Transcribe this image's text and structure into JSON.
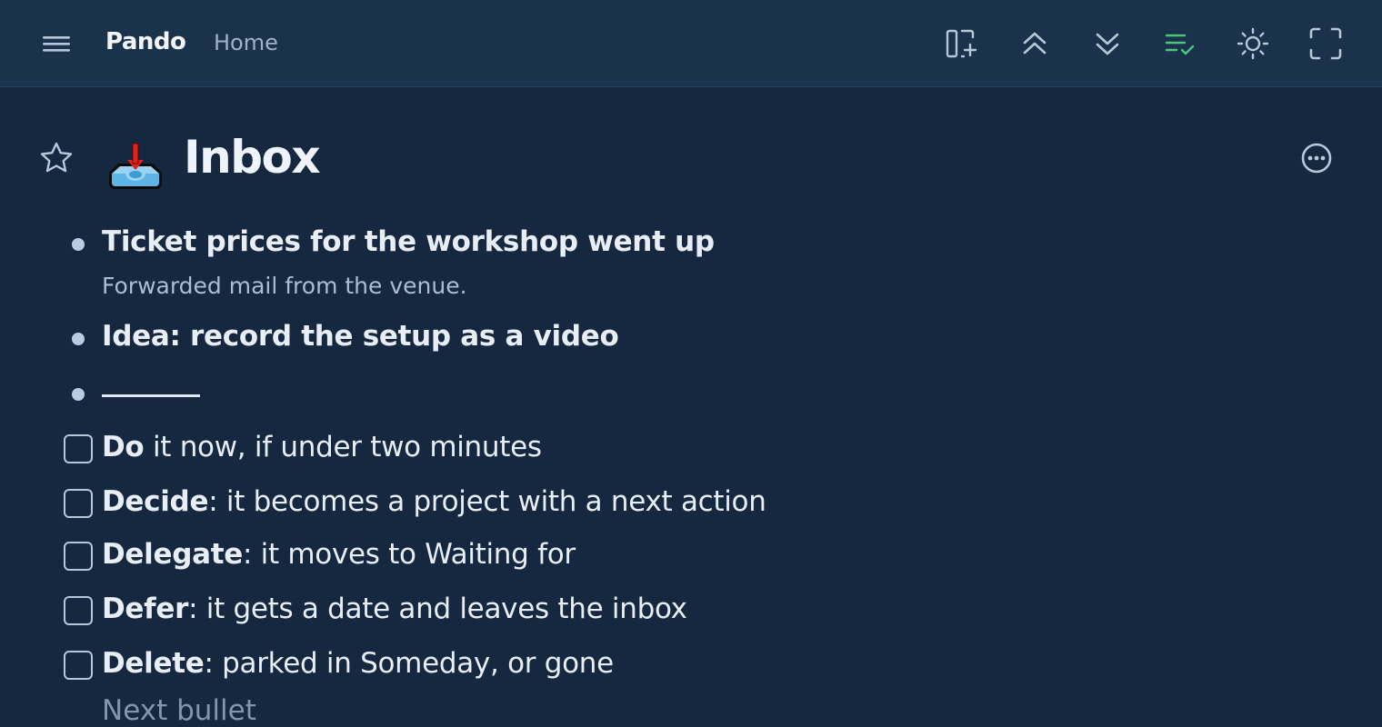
{
  "header": {
    "app_name": "Pando",
    "breadcrumb": "Home",
    "icons": [
      "menu-icon",
      "add-panel-icon",
      "collapse-all-icon",
      "expand-all-icon",
      "completed-toggle-icon",
      "theme-toggle-icon",
      "fullscreen-icon"
    ],
    "accent_color": "#4cc47a"
  },
  "page": {
    "title": "Inbox",
    "emoji": "inbox-tray-icon"
  },
  "items": [
    {
      "type": "bullet",
      "text": "Ticket prices for the workshop went up",
      "note": "Forwarded mail from the venue."
    },
    {
      "type": "bullet",
      "text": "Idea: record the setup as a video"
    },
    {
      "type": "divider"
    },
    {
      "type": "todo",
      "bold": "Do",
      "rest": " it now, if under two minutes"
    },
    {
      "type": "todo",
      "bold": "Decide",
      "rest": ": it becomes a project with a next action"
    },
    {
      "type": "todo",
      "bold": "Delegate",
      "rest": ": it moves to Waiting for"
    },
    {
      "type": "todo",
      "bold": "Defer",
      "rest": ": it gets a date and leaves the inbox"
    },
    {
      "type": "todo",
      "bold": "Delete",
      "rest": ": parked in Someday, or gone"
    }
  ],
  "partial_item": "Next bullet",
  "colors": {
    "background": "#15283f",
    "header": "#1a324b",
    "text": "#e8eef5",
    "muted": "#a9bed2"
  }
}
